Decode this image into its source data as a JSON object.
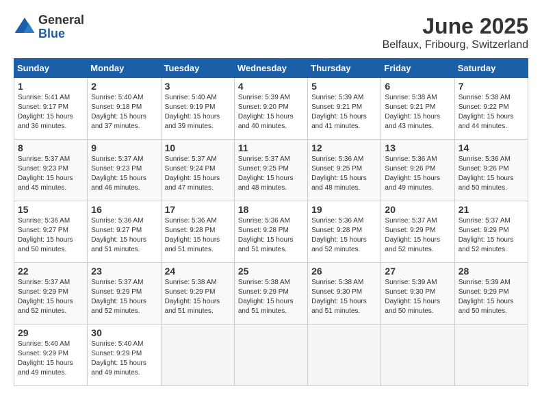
{
  "logo": {
    "general": "General",
    "blue": "Blue"
  },
  "title": "June 2025",
  "subtitle": "Belfaux, Fribourg, Switzerland",
  "days_header": [
    "Sunday",
    "Monday",
    "Tuesday",
    "Wednesday",
    "Thursday",
    "Friday",
    "Saturday"
  ],
  "weeks": [
    [
      {
        "num": "1",
        "info": "Sunrise: 5:41 AM\nSunset: 9:17 PM\nDaylight: 15 hours\nand 36 minutes."
      },
      {
        "num": "2",
        "info": "Sunrise: 5:40 AM\nSunset: 9:18 PM\nDaylight: 15 hours\nand 37 minutes."
      },
      {
        "num": "3",
        "info": "Sunrise: 5:40 AM\nSunset: 9:19 PM\nDaylight: 15 hours\nand 39 minutes."
      },
      {
        "num": "4",
        "info": "Sunrise: 5:39 AM\nSunset: 9:20 PM\nDaylight: 15 hours\nand 40 minutes."
      },
      {
        "num": "5",
        "info": "Sunrise: 5:39 AM\nSunset: 9:21 PM\nDaylight: 15 hours\nand 41 minutes."
      },
      {
        "num": "6",
        "info": "Sunrise: 5:38 AM\nSunset: 9:21 PM\nDaylight: 15 hours\nand 43 minutes."
      },
      {
        "num": "7",
        "info": "Sunrise: 5:38 AM\nSunset: 9:22 PM\nDaylight: 15 hours\nand 44 minutes."
      }
    ],
    [
      {
        "num": "8",
        "info": "Sunrise: 5:37 AM\nSunset: 9:23 PM\nDaylight: 15 hours\nand 45 minutes."
      },
      {
        "num": "9",
        "info": "Sunrise: 5:37 AM\nSunset: 9:23 PM\nDaylight: 15 hours\nand 46 minutes."
      },
      {
        "num": "10",
        "info": "Sunrise: 5:37 AM\nSunset: 9:24 PM\nDaylight: 15 hours\nand 47 minutes."
      },
      {
        "num": "11",
        "info": "Sunrise: 5:37 AM\nSunset: 9:25 PM\nDaylight: 15 hours\nand 48 minutes."
      },
      {
        "num": "12",
        "info": "Sunrise: 5:36 AM\nSunset: 9:25 PM\nDaylight: 15 hours\nand 48 minutes."
      },
      {
        "num": "13",
        "info": "Sunrise: 5:36 AM\nSunset: 9:26 PM\nDaylight: 15 hours\nand 49 minutes."
      },
      {
        "num": "14",
        "info": "Sunrise: 5:36 AM\nSunset: 9:26 PM\nDaylight: 15 hours\nand 50 minutes."
      }
    ],
    [
      {
        "num": "15",
        "info": "Sunrise: 5:36 AM\nSunset: 9:27 PM\nDaylight: 15 hours\nand 50 minutes."
      },
      {
        "num": "16",
        "info": "Sunrise: 5:36 AM\nSunset: 9:27 PM\nDaylight: 15 hours\nand 51 minutes."
      },
      {
        "num": "17",
        "info": "Sunrise: 5:36 AM\nSunset: 9:28 PM\nDaylight: 15 hours\nand 51 minutes."
      },
      {
        "num": "18",
        "info": "Sunrise: 5:36 AM\nSunset: 9:28 PM\nDaylight: 15 hours\nand 51 minutes."
      },
      {
        "num": "19",
        "info": "Sunrise: 5:36 AM\nSunset: 9:28 PM\nDaylight: 15 hours\nand 52 minutes."
      },
      {
        "num": "20",
        "info": "Sunrise: 5:37 AM\nSunset: 9:29 PM\nDaylight: 15 hours\nand 52 minutes."
      },
      {
        "num": "21",
        "info": "Sunrise: 5:37 AM\nSunset: 9:29 PM\nDaylight: 15 hours\nand 52 minutes."
      }
    ],
    [
      {
        "num": "22",
        "info": "Sunrise: 5:37 AM\nSunset: 9:29 PM\nDaylight: 15 hours\nand 52 minutes."
      },
      {
        "num": "23",
        "info": "Sunrise: 5:37 AM\nSunset: 9:29 PM\nDaylight: 15 hours\nand 52 minutes."
      },
      {
        "num": "24",
        "info": "Sunrise: 5:38 AM\nSunset: 9:29 PM\nDaylight: 15 hours\nand 51 minutes."
      },
      {
        "num": "25",
        "info": "Sunrise: 5:38 AM\nSunset: 9:29 PM\nDaylight: 15 hours\nand 51 minutes."
      },
      {
        "num": "26",
        "info": "Sunrise: 5:38 AM\nSunset: 9:30 PM\nDaylight: 15 hours\nand 51 minutes."
      },
      {
        "num": "27",
        "info": "Sunrise: 5:39 AM\nSunset: 9:30 PM\nDaylight: 15 hours\nand 50 minutes."
      },
      {
        "num": "28",
        "info": "Sunrise: 5:39 AM\nSunset: 9:29 PM\nDaylight: 15 hours\nand 50 minutes."
      }
    ],
    [
      {
        "num": "29",
        "info": "Sunrise: 5:40 AM\nSunset: 9:29 PM\nDaylight: 15 hours\nand 49 minutes."
      },
      {
        "num": "30",
        "info": "Sunrise: 5:40 AM\nSunset: 9:29 PM\nDaylight: 15 hours\nand 49 minutes."
      },
      null,
      null,
      null,
      null,
      null
    ]
  ]
}
